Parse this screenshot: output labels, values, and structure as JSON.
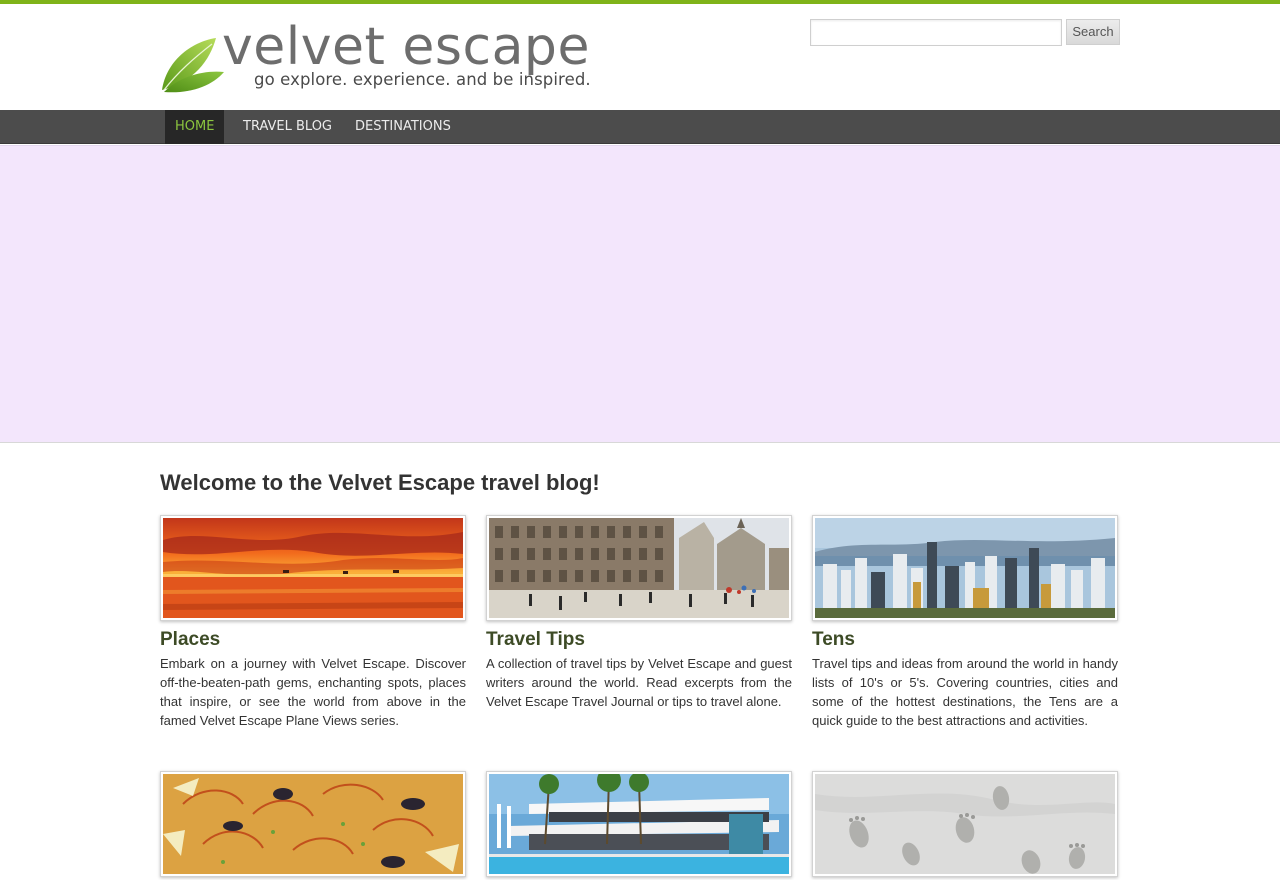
{
  "header": {
    "logo_title": "velvet escape",
    "logo_tagline": "go explore. experience. and be inspired.",
    "accent_color": "#7fb319"
  },
  "search": {
    "placeholder": "",
    "value": "",
    "button_label": "Search"
  },
  "nav": {
    "items": [
      {
        "label": "HOME",
        "active": true
      },
      {
        "label": "TRAVEL BLOG",
        "active": false
      },
      {
        "label": "DESTINATIONS",
        "active": false
      }
    ],
    "active_color": "#8cc63f"
  },
  "main": {
    "welcome": "Welcome to the Velvet Escape travel blog!",
    "cards": [
      {
        "title": "Places",
        "image": "sunset-sea-photo",
        "description": "Embark on a journey with Velvet Escape. Discover off-the-beaten-path gems, enchanting spots, places that inspire, or see the world from above in the famed Velvet Escape Plane Views series."
      },
      {
        "title": "Travel Tips",
        "image": "city-square-photo",
        "description": "A collection of travel tips by Velvet Escape and guest writers around the world. Read excerpts from the Velvet Escape Travel Journal or tips to travel alone."
      },
      {
        "title": "Tens",
        "image": "skyline-harbour-photo",
        "description": "Travel tips and ideas from around the world in handy lists of 10's or 5's. Covering countries, cities and some of the hottest destinations, the Tens are a quick guide to the best attractions and activities."
      },
      {
        "title": "",
        "image": "paella-photo",
        "description": ""
      },
      {
        "title": "",
        "image": "modern-hotel-pool-photo",
        "description": ""
      },
      {
        "title": "",
        "image": "footprints-sand-photo",
        "description": ""
      }
    ]
  }
}
